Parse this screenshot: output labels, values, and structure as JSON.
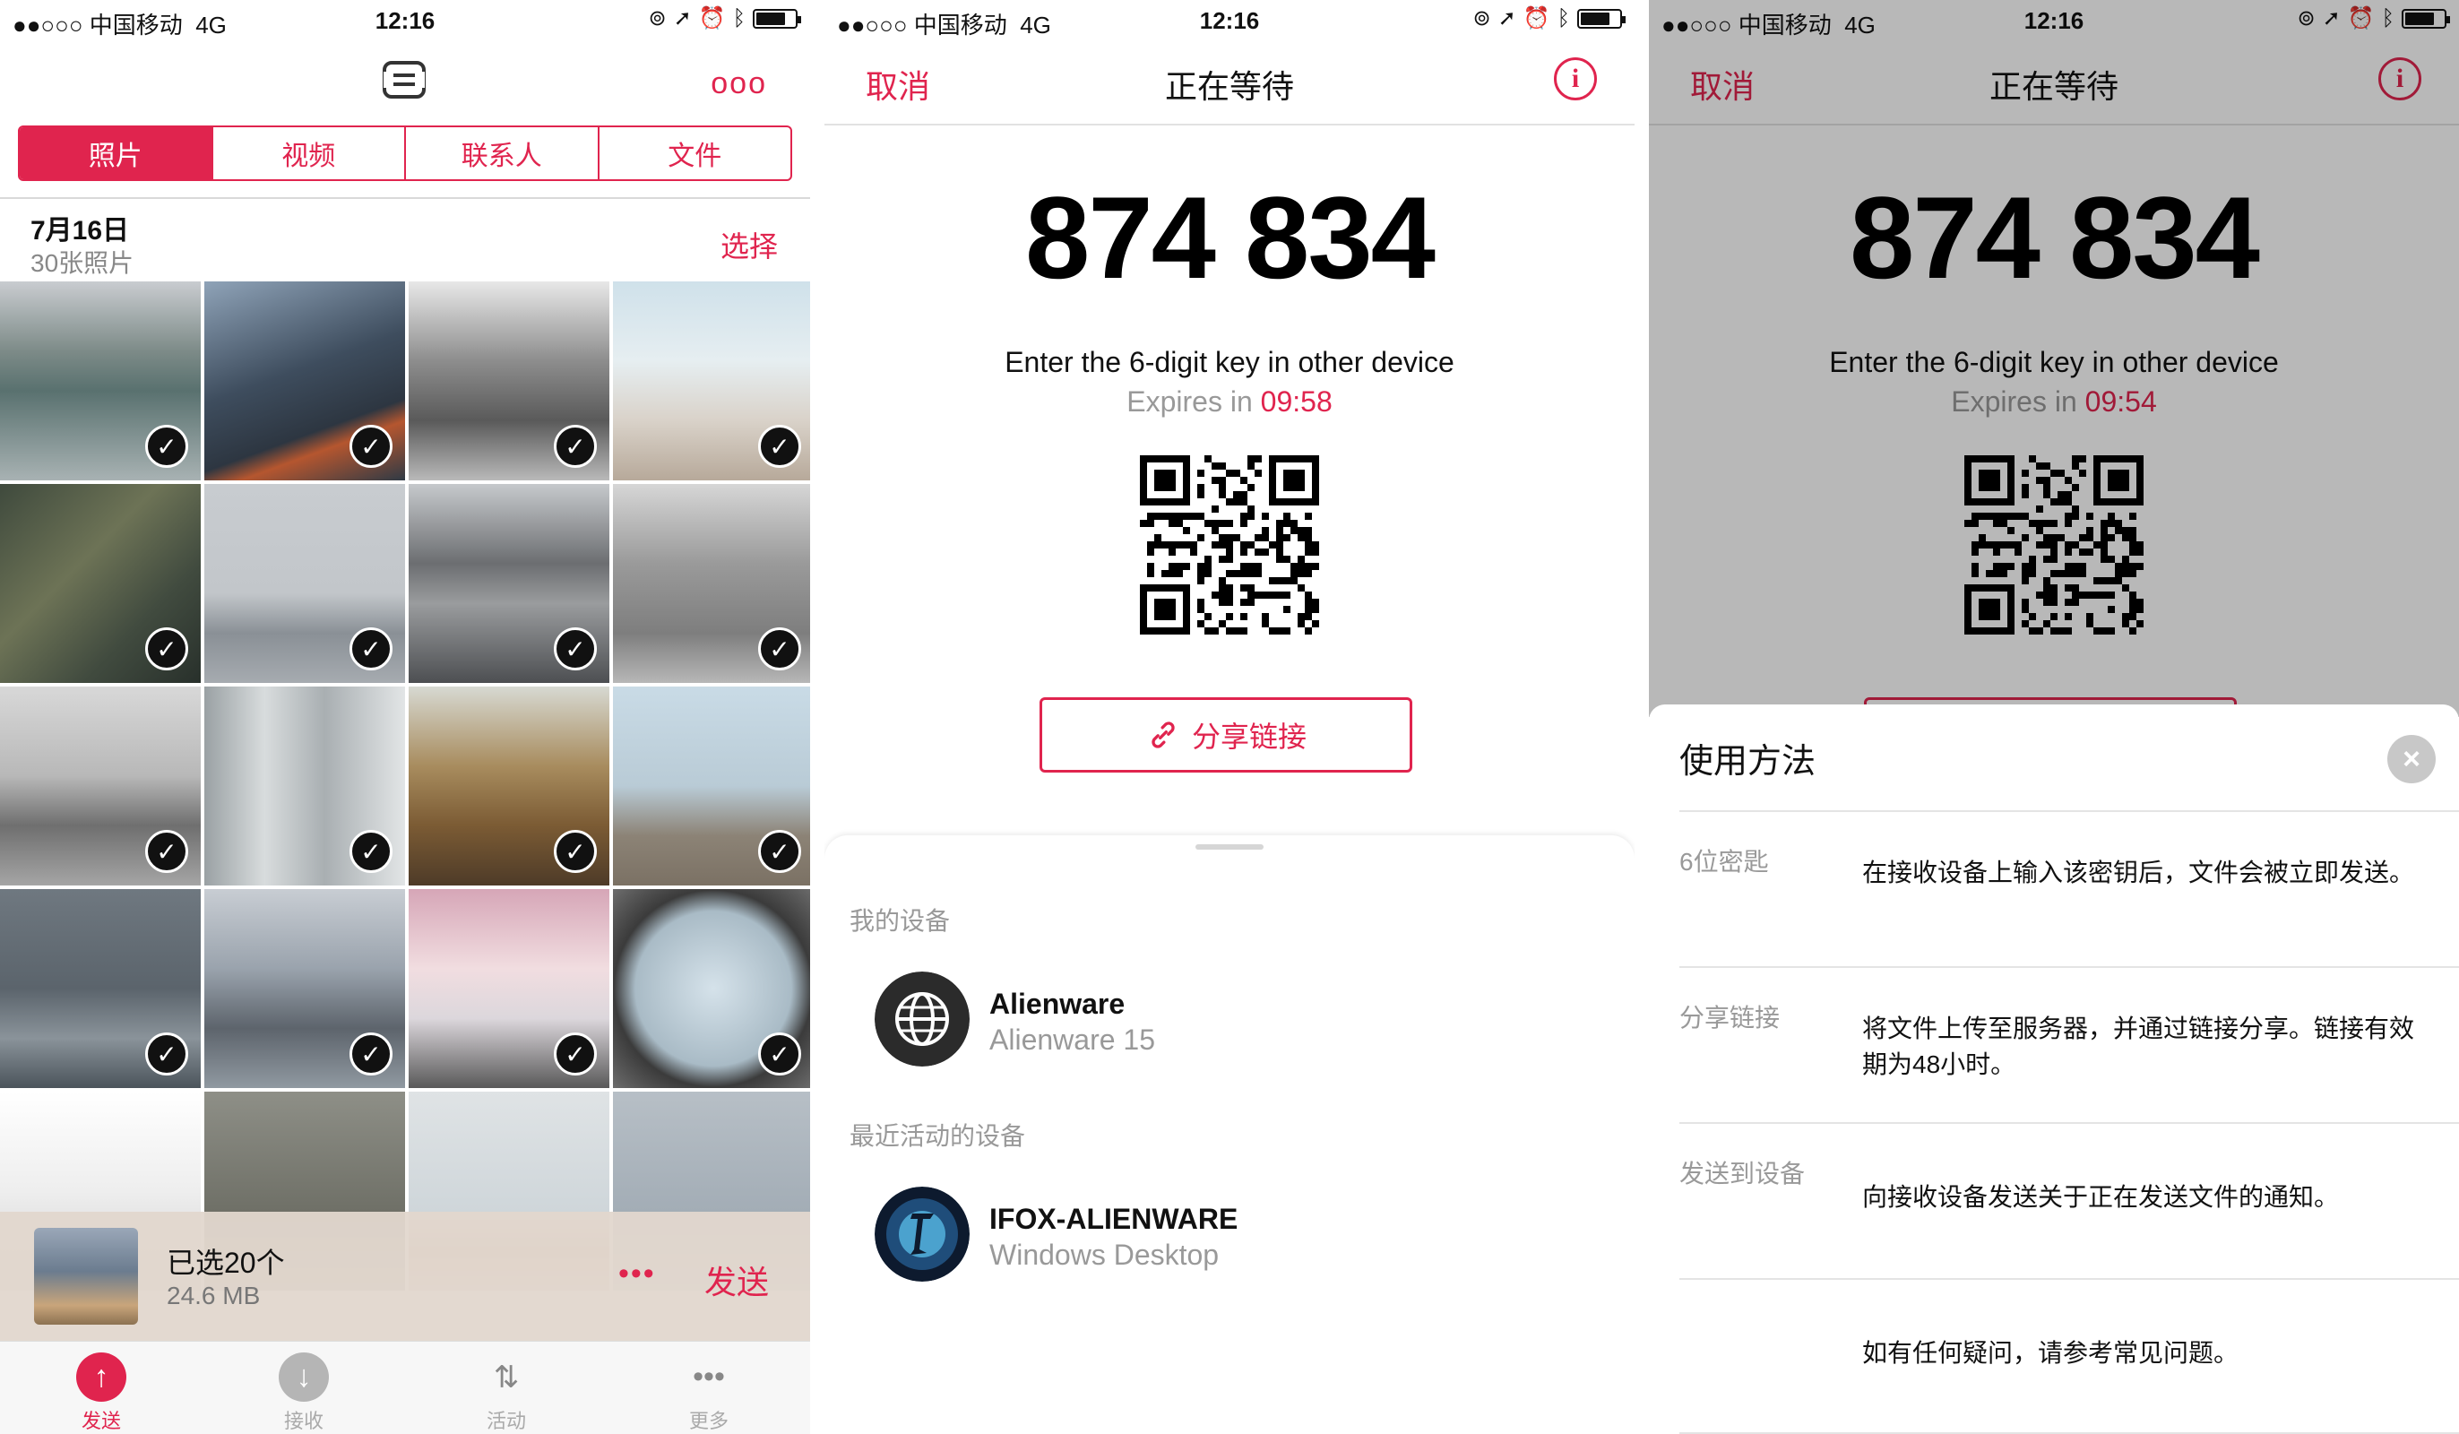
{
  "status": {
    "carrier": "●●○○○ 中国移动",
    "network": "4G",
    "time": "12:16",
    "battery_fraction": 0.75
  },
  "panel1": {
    "more_label": "ooo",
    "segments": [
      "照片",
      "视频",
      "联系人",
      "文件"
    ],
    "active_segment": 0,
    "date_title": "7月16日",
    "date_sub": "30张照片",
    "select_label": "选择",
    "selection": {
      "title": "已选20个",
      "size": "24.6 MB",
      "dots": "•••",
      "send_label": "发送"
    },
    "tabs": [
      {
        "label": "发送",
        "icon": "arrow-up-icon"
      },
      {
        "label": "接收",
        "icon": "arrow-down-icon"
      },
      {
        "label": "活动",
        "icon": "transfer-icon"
      },
      {
        "label": "更多",
        "icon": "more-icon"
      }
    ],
    "check_glyph": "✓",
    "accent": "#e0244e"
  },
  "panel2": {
    "cancel": "取消",
    "title": "正在等待",
    "info": "i",
    "key": "874 834",
    "instruction": "Enter the 6-digit key in other device",
    "expires_prefix": "Expires in ",
    "expires_time": "09:58",
    "share_label": "分享链接",
    "my_devices_label": "我的设备",
    "recent_devices_label": "最近活动的设备",
    "my_devices": [
      {
        "name": "Alienware",
        "sub": "Alienware 15",
        "icon": "globe-icon"
      }
    ],
    "recent_devices": [
      {
        "name": "IFOX-ALIENWARE",
        "sub": "Windows Desktop",
        "icon": "avatar-icon"
      }
    ]
  },
  "panel3": {
    "cancel": "取消",
    "title": "正在等待",
    "info": "i",
    "key": "874 834",
    "instruction": "Enter the 6-digit key in other device",
    "expires_prefix": "Expires in ",
    "expires_time": "09:54",
    "help": {
      "title": "使用方法",
      "close": "×",
      "rows": [
        {
          "key": "6位密匙",
          "value": "在接收设备上输入该密钥后，文件会被立即发送。"
        },
        {
          "key": "分享链接",
          "value": "将文件上传至服务器，并通过链接分享。链接有效期为48小时。"
        },
        {
          "key": "发送到设备",
          "value": "向接收设备发送关于正在发送文件的通知。"
        },
        {
          "key": "",
          "value": "如有任何疑问，请参考常见问题。"
        }
      ]
    }
  }
}
